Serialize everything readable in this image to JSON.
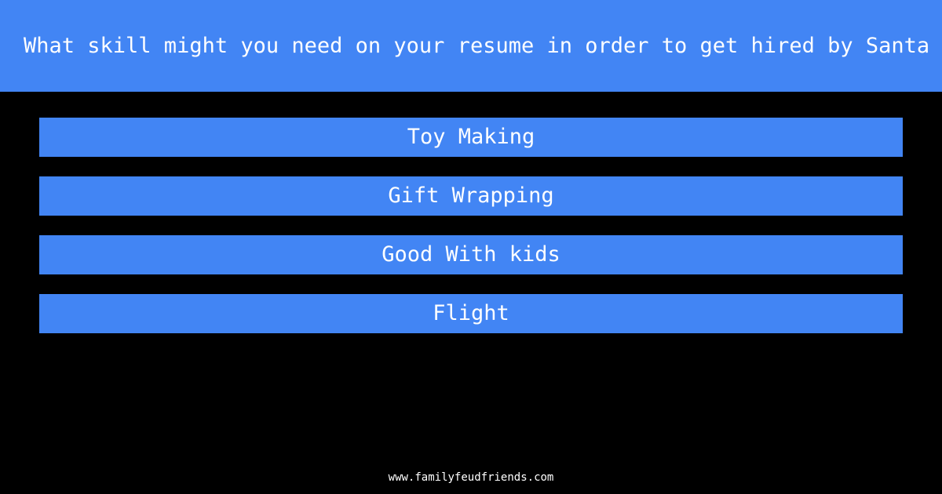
{
  "theme": {
    "background": "#000000",
    "accent_blue": "#4285f4",
    "text_color": "#ffffff"
  },
  "header": {
    "question": "What skill might you need on your resume in order to get hired by Santa"
  },
  "answers": [
    {
      "label": "Toy Making"
    },
    {
      "label": "Gift Wrapping"
    },
    {
      "label": "Good With kids"
    },
    {
      "label": "Flight"
    }
  ],
  "footer": {
    "url": "www.familyfeudfriends.com"
  }
}
